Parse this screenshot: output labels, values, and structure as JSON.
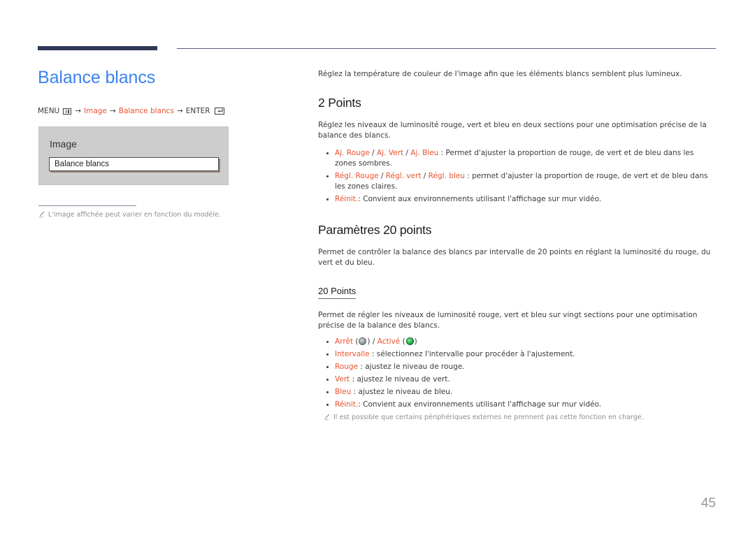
{
  "page": {
    "number": "45",
    "title": "Balance blancs"
  },
  "breadcrumb": {
    "menu_label": "MENU",
    "menu_icon": "menu-grid-icon",
    "arrow": "→",
    "items": [
      "Image",
      "Balance blancs"
    ],
    "enter_label": "ENTER",
    "enter_icon": "enter-key-icon"
  },
  "osd": {
    "section_label": "Image",
    "selected_item": "Balance blancs"
  },
  "left_note": {
    "icon": "pencil-icon",
    "text": "L'image affichée peut varier en fonction du modèle."
  },
  "main": {
    "intro": "Réglez la température de couleur de l'image afin que les éléments blancs semblent plus lumineux.",
    "sections": [
      {
        "heading": "2 Points",
        "body": "Réglez les niveaux de luminosité rouge, vert et bleu en deux sections pour une optimisation précise de la balance des blancs.",
        "bullets": [
          {
            "terms": [
              "Aj. Rouge",
              "Aj. Vert",
              "Aj. Bleu"
            ],
            "desc": " : Permet d'ajuster la proportion de rouge, de vert et de bleu dans les zones sombres."
          },
          {
            "terms": [
              "Régl. Rouge",
              "Régl. vert",
              "Régl. bleu"
            ],
            "desc": " : permet d'ajuster la proportion de rouge, de vert et de bleu dans les zones claires."
          },
          {
            "terms": [
              "Réinit."
            ],
            "desc": ": Convient aux environnements utilisant l'affichage sur mur vidéo."
          }
        ]
      },
      {
        "heading": "Paramètres 20 points",
        "body": "Permet de contrôler la balance des blancs par intervalle de 20 points en réglant la luminosité du rouge, du vert et du bleu.",
        "subheading": "20 Points",
        "subbody": "Permet de régler les niveaux de luminosité rouge, vert et bleu sur vingt sections pour une optimisation précise de la balance des blancs.",
        "bullets": [
          {
            "toggle": true,
            "off_label": "Arrêt",
            "off_icon": "led-off-icon",
            "slash": " / ",
            "on_label": "Activé",
            "on_icon": "led-on-icon"
          },
          {
            "terms": [
              "Intervalle"
            ],
            "desc": " : sélectionnez l'intervalle pour procéder à l'ajustement."
          },
          {
            "terms": [
              "Rouge"
            ],
            "desc": " : ajustez le niveau de rouge."
          },
          {
            "terms": [
              "Vert"
            ],
            "desc": " : ajustez le niveau de vert."
          },
          {
            "terms": [
              "Bleu"
            ],
            "desc": " : ajustez le niveau de bleu."
          },
          {
            "terms": [
              "Réinit."
            ],
            "desc": ": Convient aux environnements utilisant l'affichage sur mur vidéo."
          }
        ],
        "note": {
          "icon": "pencil-icon",
          "text": "Il est possible que certains périphériques externes ne prennent pas cette fonction en charge."
        }
      }
    ]
  },
  "colors": {
    "title_blue": "#3c82f0",
    "accent_orange": "#e8522e",
    "rule_navy": "#2f3757",
    "osd_gray": "#cdcdcd",
    "note_gray": "#8f8f8f",
    "led_on_green": "#23b24a",
    "led_off_gray": "#9aa0a3"
  }
}
